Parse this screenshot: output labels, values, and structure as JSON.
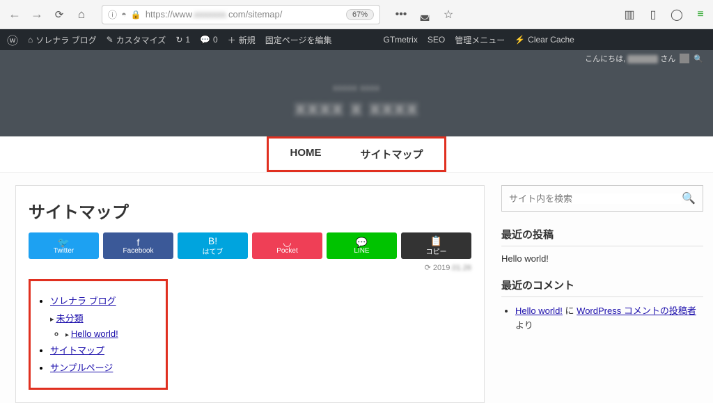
{
  "browser": {
    "url_prefix": "https://www",
    "url_suffix": "com/sitemap/",
    "zoom": "67%"
  },
  "wp_admin": {
    "site_name": "ソレナラ ブログ",
    "customize": "カスタマイズ",
    "refresh_count": "1",
    "comment_count": "0",
    "new": "新規",
    "edit_page": "固定ページを編集",
    "gtmetrix": "GTmetrix",
    "seo": "SEO",
    "admin_menu": "管理メニュー",
    "clear_cache": "Clear Cache",
    "greeting_prefix": "こんにちは, ",
    "greeting_suffix": " さん"
  },
  "header": {
    "subtitle": "xxxxx xxxx",
    "title": "xxxx x xxxx"
  },
  "nav": {
    "home": "HOME",
    "sitemap": "サイトマップ"
  },
  "main": {
    "title": "サイトマップ",
    "share": {
      "twitter": "Twitter",
      "facebook": "Facebook",
      "hatebu": "はてブ",
      "pocket": "Pocket",
      "line": "LINE",
      "copy": "コピー"
    },
    "date_prefix": "2019",
    "date_blur": ".01.26",
    "sitemap": {
      "top": "ソレナラ ブログ",
      "cat1": "未分類",
      "post1": "Hello world!",
      "page1": "サイトマップ",
      "page2": "サンプルページ"
    }
  },
  "sidebar": {
    "search_placeholder": "サイト内を検索",
    "recent_posts_title": "最近の投稿",
    "recent_post1": "Hello world!",
    "recent_comments_title": "最近のコメント",
    "comment_link1": "Hello world!",
    "comment_mid": " に ",
    "comment_link2": "WordPress コメントの投稿者",
    "comment_suffix": " より"
  }
}
